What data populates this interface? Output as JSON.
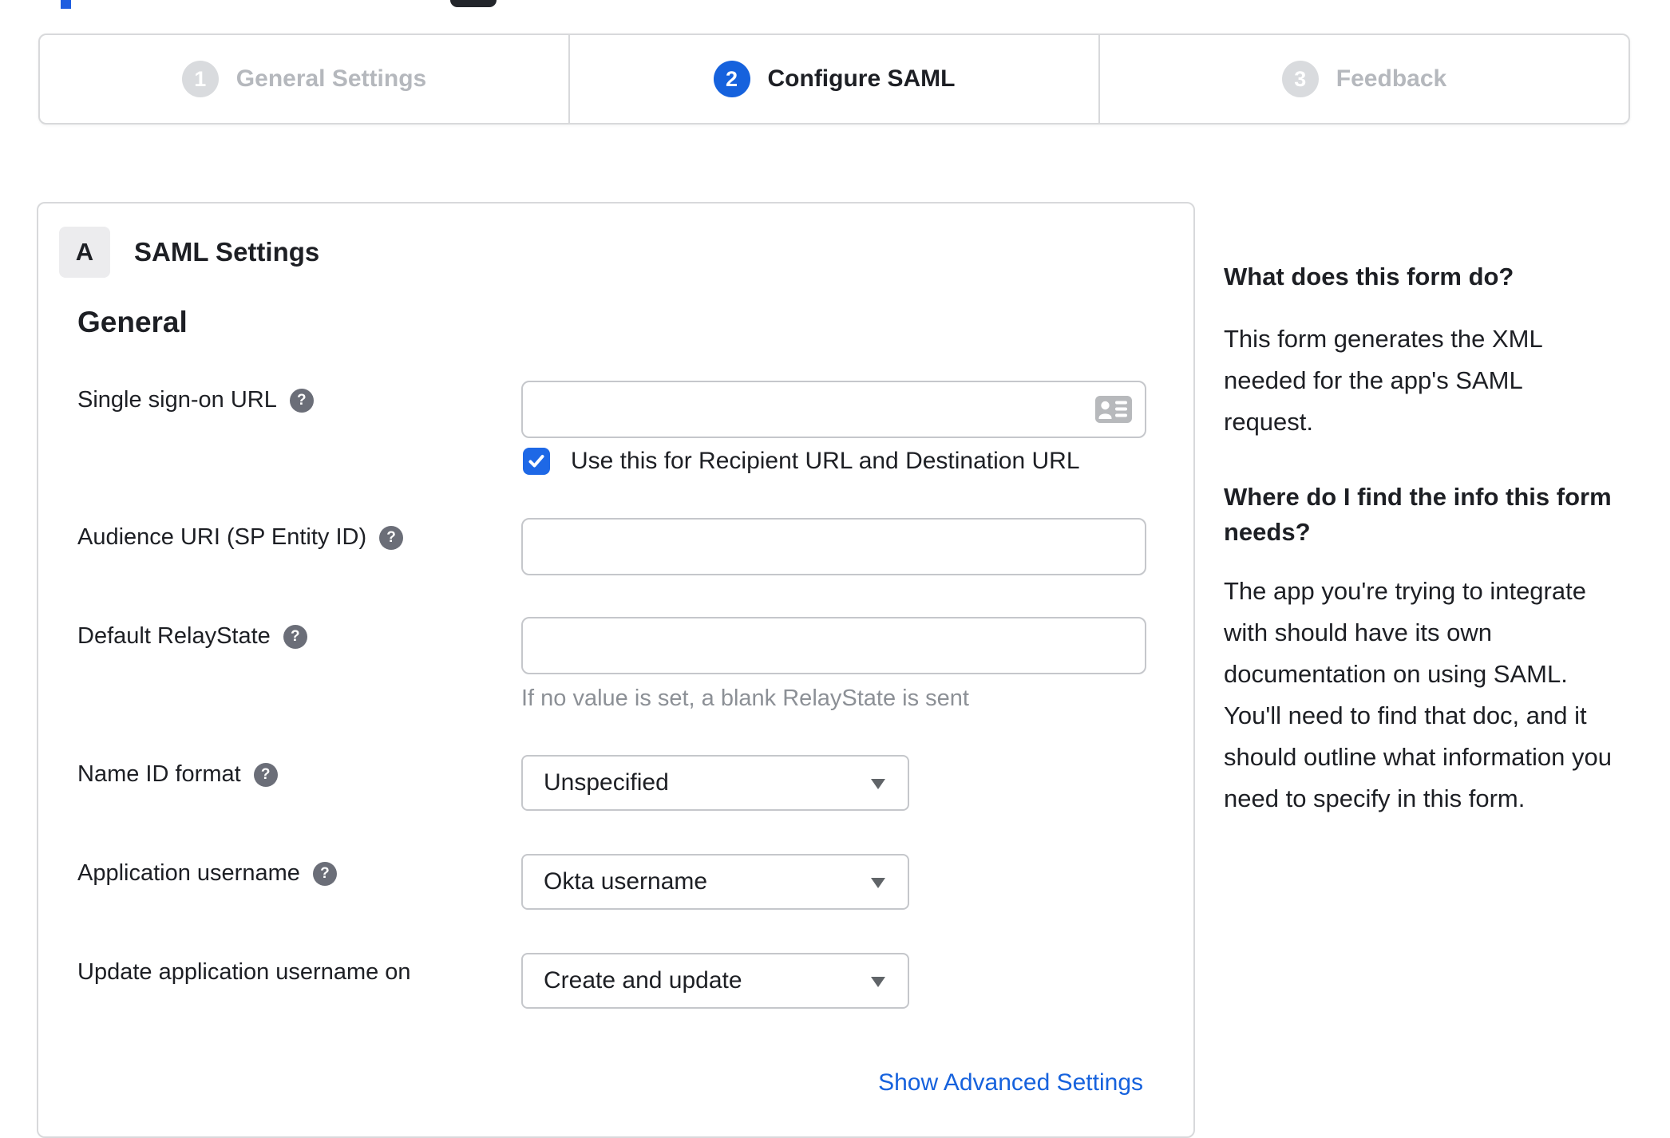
{
  "stepper": {
    "steps": [
      {
        "number": "1",
        "label": "General Settings",
        "state": "inactive"
      },
      {
        "number": "2",
        "label": "Configure SAML",
        "state": "active"
      },
      {
        "number": "3",
        "label": "Feedback",
        "state": "inactive"
      }
    ]
  },
  "panel": {
    "badge": "A",
    "title": "SAML Settings",
    "section_heading": "General",
    "fields": {
      "sso": {
        "label": "Single sign-on URL",
        "value": "",
        "checkbox_label": "Use this for Recipient URL and Destination URL",
        "checkbox_checked": true
      },
      "audience": {
        "label": "Audience URI (SP Entity ID)",
        "value": ""
      },
      "relay": {
        "label": "Default RelayState",
        "value": "",
        "helper": "If no value is set, a blank RelayState is sent"
      },
      "name_id": {
        "label": "Name ID format",
        "value": "Unspecified"
      },
      "app_username": {
        "label": "Application username",
        "value": "Okta username"
      },
      "update_username": {
        "label": "Update application username on",
        "value": "Create and update"
      }
    },
    "advanced_link": "Show Advanced Settings"
  },
  "sidebar": {
    "heading1": "What does this form do?",
    "para1": "This form generates the XML needed for the app's SAML request.",
    "heading2": "Where do I find the info this form needs?",
    "para2": "The app you're trying to integrate with should have its own documentation on using SAML. You'll need to find that doc, and it should outline what information you need to specify in this form."
  },
  "icons": {
    "help_glyph": "?"
  },
  "colors": {
    "accent_blue": "#1662dd",
    "checkbox_blue": "#1e68e6",
    "inactive_gray": "#d9dbde",
    "border_gray": "#d8d9db",
    "helper_gray": "#8c9096"
  }
}
